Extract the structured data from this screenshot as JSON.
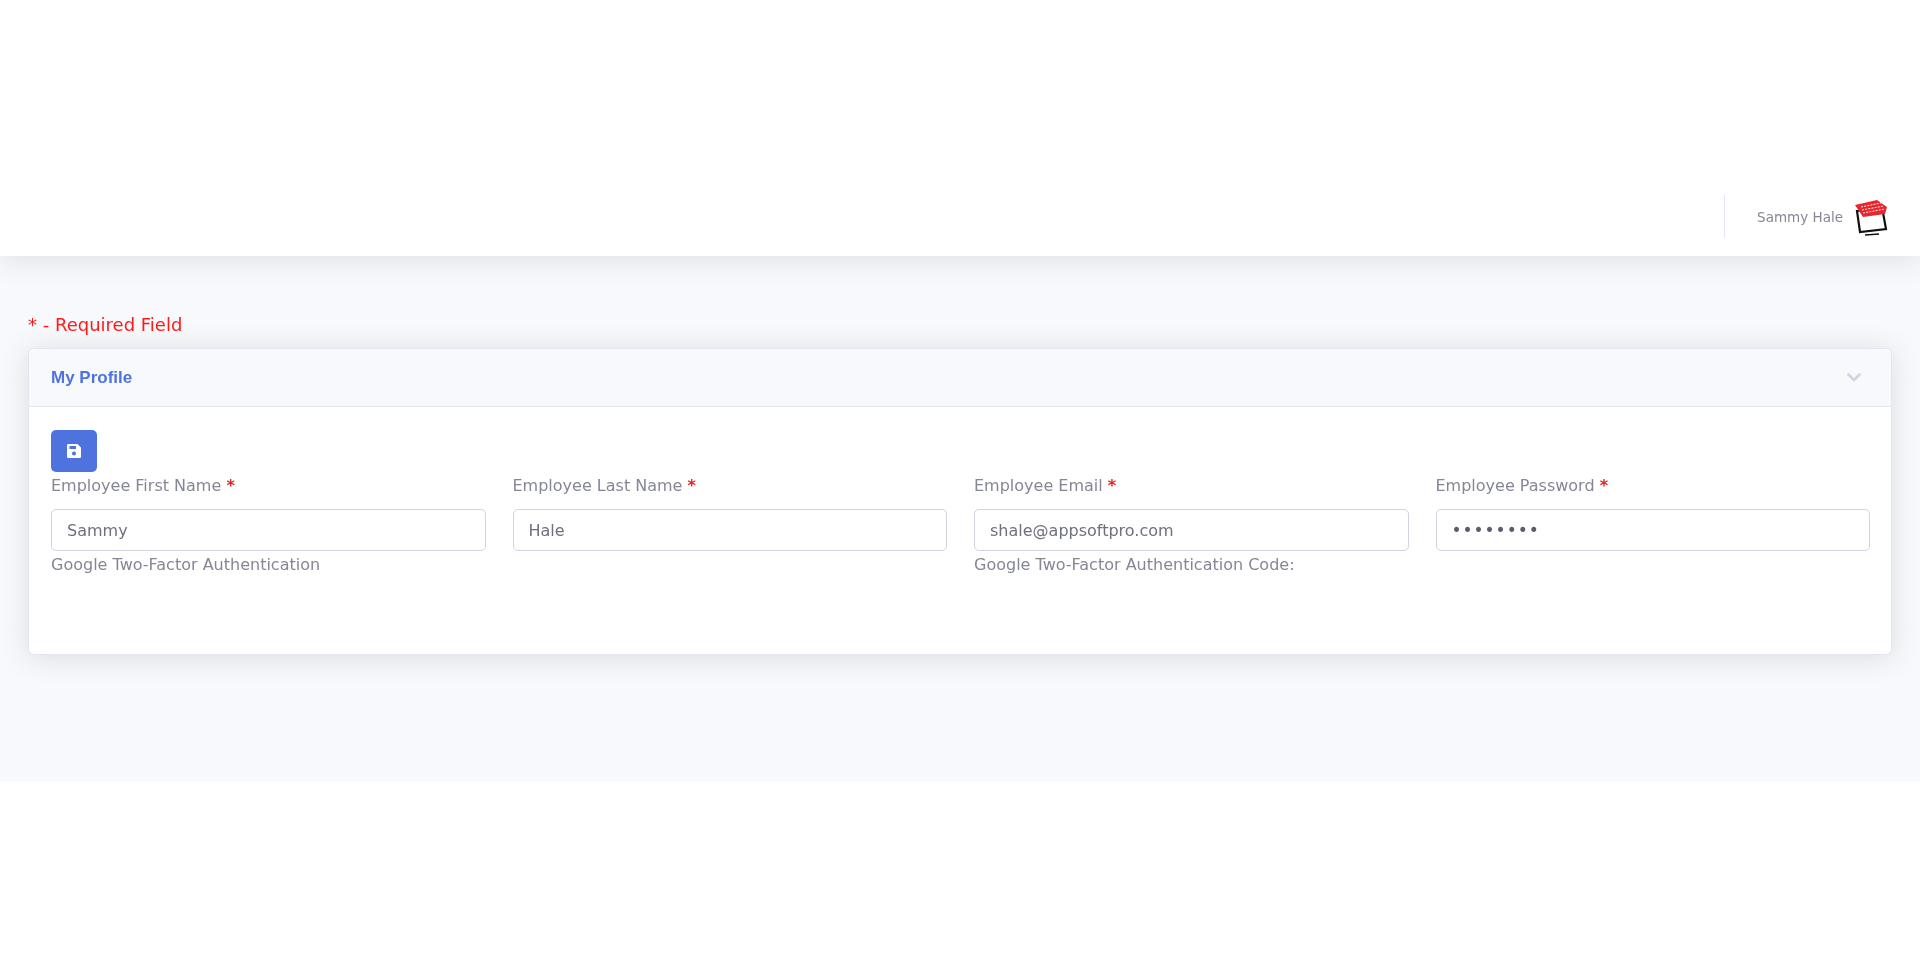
{
  "header": {
    "user_name": "Sammy Hale"
  },
  "required_note": "* - Required Field",
  "card": {
    "title": "My Profile",
    "fields": [
      {
        "kind": "text",
        "label": "Employee First Name",
        "required_mark": "*",
        "value": "Sammy",
        "help": "Google Two-Factor Authentication"
      },
      {
        "kind": "text",
        "label": "Employee Last Name",
        "required_mark": "*",
        "value": "Hale"
      },
      {
        "kind": "email",
        "label": "Employee Email",
        "required_mark": "*",
        "value": "shale@appsoftpro.com",
        "help": "Google Two-Factor Authentication Code:"
      },
      {
        "kind": "password",
        "label": "Employee Password",
        "required_mark": "*",
        "value": "••••••••"
      }
    ]
  }
}
